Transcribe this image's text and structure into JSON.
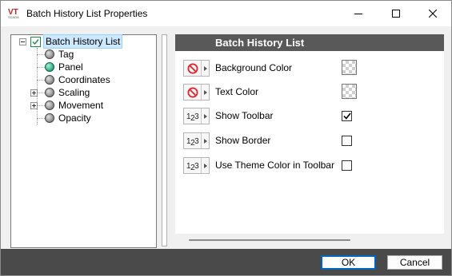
{
  "window": {
    "title": "Batch History List Properties",
    "app_logo_text": "VT",
    "app_logo_subtext": "SCADA"
  },
  "tree": {
    "root": {
      "label": "Batch History List",
      "icon": "batch-list-icon",
      "expanded": true,
      "selected": true
    },
    "items": [
      {
        "label": "Tag",
        "icon": "grey-ball-icon",
        "expandable": false
      },
      {
        "label": "Panel",
        "icon": "green-ball-icon",
        "expandable": false
      },
      {
        "label": "Coordinates",
        "icon": "grey-ball-icon",
        "expandable": false
      },
      {
        "label": "Scaling",
        "icon": "grey-ball-icon",
        "expandable": true
      },
      {
        "label": "Movement",
        "icon": "grey-ball-icon",
        "expandable": true
      },
      {
        "label": "Opacity",
        "icon": "grey-ball-icon",
        "expandable": false
      }
    ]
  },
  "properties": {
    "header": "Batch History List",
    "rows": [
      {
        "label": "Background Color",
        "mode_icon": "no-link-icon",
        "type": "color",
        "value": "transparent"
      },
      {
        "label": "Text Color",
        "mode_icon": "no-link-icon",
        "type": "color",
        "value": "transparent"
      },
      {
        "label": "Show Toolbar",
        "mode_icon": "numeric-icon",
        "type": "checkbox",
        "checked": true
      },
      {
        "label": "Show Border",
        "mode_icon": "numeric-icon",
        "type": "checkbox",
        "checked": false
      },
      {
        "label": "Use Theme Color in Toolbar",
        "mode_icon": "numeric-icon",
        "type": "checkbox",
        "checked": false
      }
    ]
  },
  "buttons": {
    "ok": "OK",
    "cancel": "Cancel"
  },
  "colors": {
    "header_bg": "#595959",
    "bottom_bar": "#4a4a4a",
    "selection": "#cce8ff",
    "no_link_red": "#e8202a",
    "panel_green": "#2fb08a"
  }
}
